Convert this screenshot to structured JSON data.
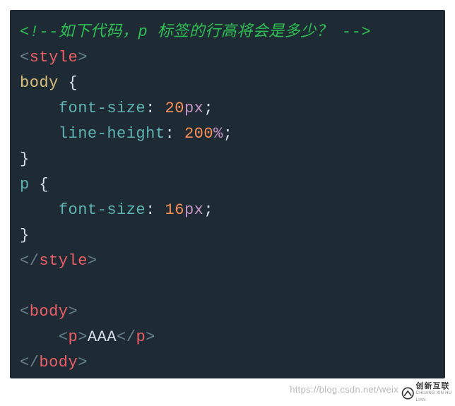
{
  "code": {
    "l1_comment_open": "<!--",
    "l1_comment_text": "如下代码，p 标签的行高将会是多少？",
    "l1_comment_close": "-->",
    "l2_lt": "<",
    "l2_tag": "style",
    "l2_gt": ">",
    "l3_selector": "body",
    "l3_brace": " {",
    "l4_indent": "    ",
    "l4_prop": "font-size",
    "l4_colon": ": ",
    "l4_val": "20",
    "l4_unit": "px",
    "l4_semi": ";",
    "l5_indent": "    ",
    "l5_prop": "line-height",
    "l5_colon": ": ",
    "l5_val": "200",
    "l5_unit": "%",
    "l5_semi": ";",
    "l6_brace": "}",
    "l7_selector": "p",
    "l7_brace": " {",
    "l8_indent": "    ",
    "l8_prop": "font-size",
    "l8_colon": ": ",
    "l8_val": "16",
    "l8_unit": "px",
    "l8_semi": ";",
    "l9_brace": "}",
    "l10_lt": "</",
    "l10_tag": "style",
    "l10_gt": ">",
    "l11_blank": " ",
    "l12_lt": "<",
    "l12_tag": "body",
    "l12_gt": ">",
    "l13_indent": "    ",
    "l13_lt": "<",
    "l13_tag": "p",
    "l13_gt": ">",
    "l13_text": "AAA",
    "l13_lt2": "</",
    "l13_tag2": "p",
    "l13_gt2": ">",
    "l14_lt": "</",
    "l14_tag": "body",
    "l14_gt": ">"
  },
  "watermark": "https://blog.csdn.net/weix",
  "logo": {
    "cn": "创新互联",
    "en": "CHUANG XIN HU LIAN"
  }
}
